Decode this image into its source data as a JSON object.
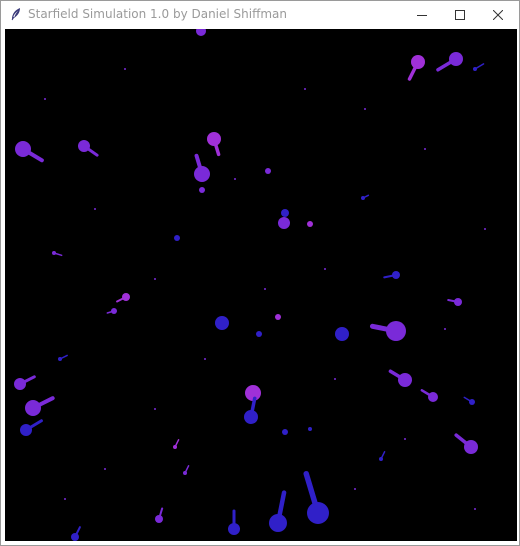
{
  "window": {
    "title": "Starfield Simulation 1.0 by Daniel Shiffman"
  },
  "colors": {
    "canvas_background": "#000000",
    "star_blue": "#3020c8",
    "star_violet": "#7a2ad8",
    "star_magenta": "#a030d8"
  },
  "icons": {
    "app": "feather-icon",
    "minimize": "minimize-icon",
    "maximize": "maximize-icon",
    "close": "close-icon"
  }
}
